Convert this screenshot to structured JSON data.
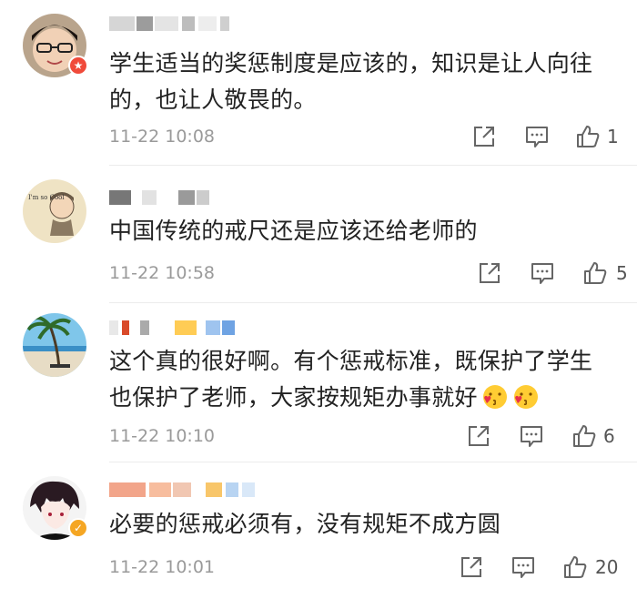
{
  "comments": [
    {
      "text": "学生适当的奖惩制度是应该的，知识是让人向往的，也让人敬畏的。",
      "time": "11-22 10:08",
      "likes": "1",
      "badge": "★"
    },
    {
      "text": "中国传统的戒尺还是应该还给老师的",
      "time": "11-22 10:58",
      "likes": "5",
      "avatar_text": "I'm so Cool"
    },
    {
      "text": "这个真的很好啊。有个惩戒标准，既保护了学生也保护了老师，大家按规矩办事就好",
      "time": "11-22 10:10",
      "likes": "6"
    },
    {
      "text": "必要的惩戒必须有，没有规矩不成方圆",
      "time": "11-22 10:01",
      "likes": "20",
      "badge": "✓"
    }
  ],
  "icons": {
    "share": "share-icon",
    "reply": "comment-icon",
    "like": "thumbs-up-icon",
    "emoji": "kissing-face-emoji"
  },
  "colors": {
    "time": "#9a9a9a",
    "text": "#222222",
    "badge_red": "#f04a3a",
    "badge_gold": "#f5a623"
  }
}
